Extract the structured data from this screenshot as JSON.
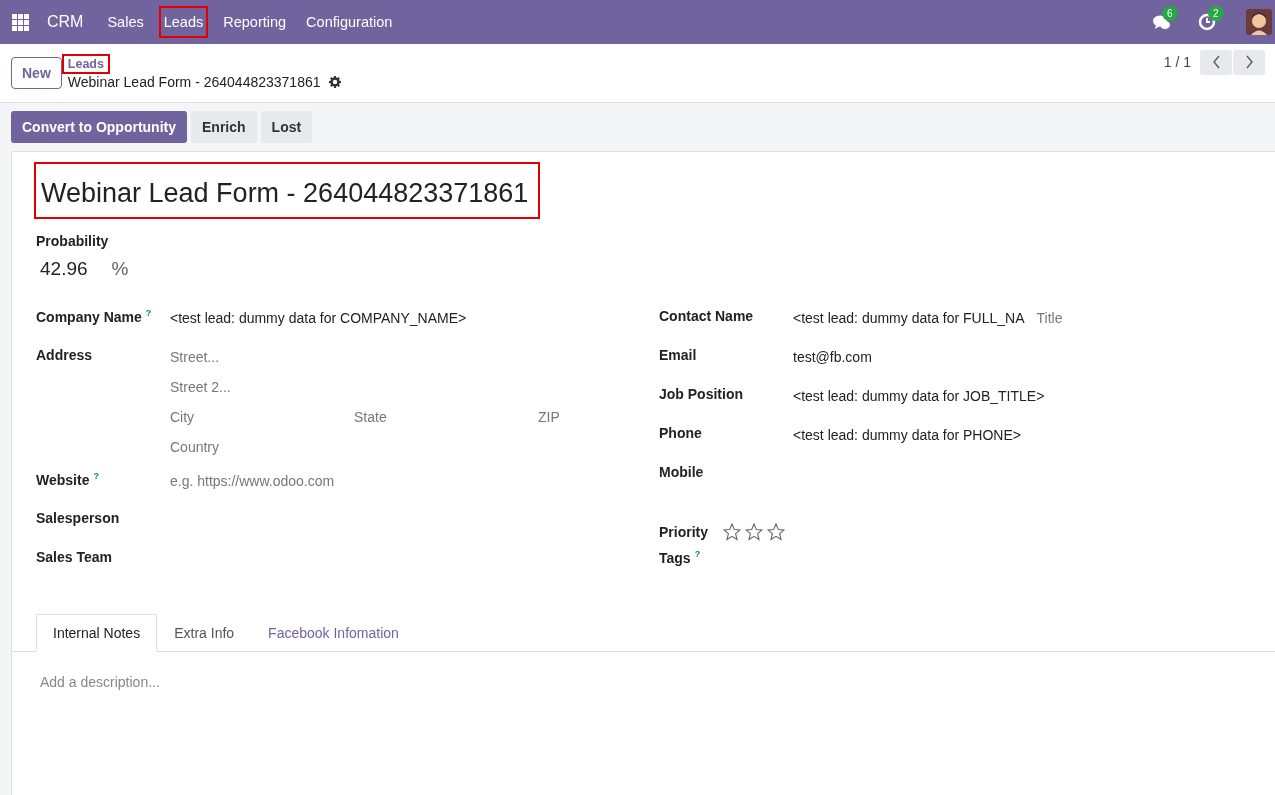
{
  "navbar": {
    "app": "CRM",
    "menu": [
      {
        "label": "Sales",
        "highlighted": false
      },
      {
        "label": "Leads",
        "highlighted": true
      },
      {
        "label": "Reporting",
        "highlighted": false
      },
      {
        "label": "Configuration",
        "highlighted": false
      }
    ],
    "messages_badge": "6",
    "activities_badge": "2"
  },
  "control_panel": {
    "new_button": "New",
    "breadcrumb": {
      "label": "Leads",
      "highlighted": true
    },
    "record_name": "Webinar Lead Form - 264044823371861",
    "pager": "1 / 1"
  },
  "actions": [
    {
      "label": "Convert to Opportunity",
      "primary": true
    },
    {
      "label": "Enrich",
      "primary": false
    },
    {
      "label": "Lost",
      "primary": false
    }
  ],
  "form": {
    "title": {
      "text": "Webinar Lead Form - 264044823371861",
      "highlighted": true
    },
    "probability": {
      "label": "Probability",
      "value": "42.96",
      "unit": "%"
    },
    "left_fields": [
      {
        "kind": "text",
        "label": "Company Name",
        "help_mark": "?",
        "value": "<test lead: dummy data for COMPANY_NAME>"
      },
      {
        "kind": "address",
        "label": "Address",
        "street": "Street...",
        "street2": "Street 2...",
        "city": "City",
        "state": "State",
        "zip": "ZIP",
        "country": "Country"
      },
      {
        "kind": "text",
        "label": "Website",
        "help_mark": "?",
        "placeholder": "e.g. https://www.odoo.com"
      },
      {
        "kind": "text",
        "label": "Salesperson"
      },
      {
        "kind": "text",
        "label": "Sales Team"
      }
    ],
    "right_fields": [
      {
        "kind": "text",
        "label": "Contact Name",
        "value": "<test lead: dummy data for FULL_NA",
        "extra_placeholder": "Title"
      },
      {
        "kind": "text",
        "label": "Email",
        "value": "test@fb.com"
      },
      {
        "kind": "text",
        "label": "Job Position",
        "value": "<test lead: dummy data for JOB_TITLE>"
      },
      {
        "kind": "text",
        "label": "Phone",
        "value": "<test lead: dummy data for PHONE>"
      },
      {
        "kind": "text",
        "label": "Mobile"
      },
      {
        "kind": "stars",
        "label": "Priority",
        "stars": 0
      },
      {
        "kind": "text",
        "label": "Tags",
        "help_mark": "?"
      }
    ],
    "tabs": [
      {
        "label": "Internal Notes",
        "selected": true,
        "hovered": false
      },
      {
        "label": "Extra Info",
        "selected": false,
        "hovered": false
      },
      {
        "label": "Facebook Infomation",
        "selected": false,
        "hovered": true
      }
    ],
    "description_placeholder": "Add a description..."
  }
}
